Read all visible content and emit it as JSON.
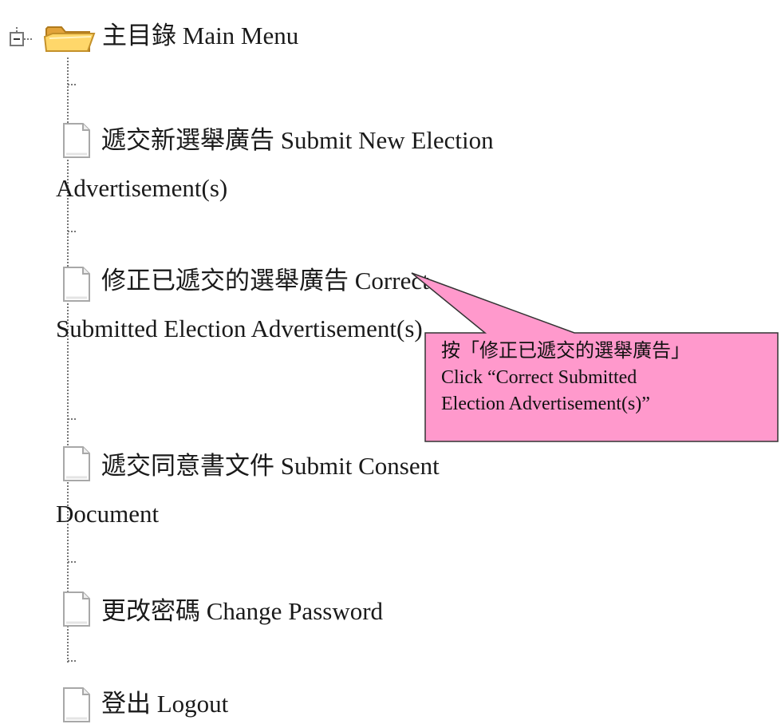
{
  "tree": {
    "root": {
      "label": "主目錄 Main Menu",
      "toggle_icon": "collapse-minus-icon",
      "folder_icon": "open-folder-icon",
      "expanded": true
    },
    "items": [
      {
        "label": "遞交新選舉廣告 Submit New Election Advertisement(s)",
        "icon": "document-icon"
      },
      {
        "label": "修正已遞交的選舉廣告 Correct Submitted Election Advertisement(s)",
        "icon": "document-icon"
      },
      {
        "label": "遞交同意書文件 Submit Consent Document",
        "icon": "document-icon"
      },
      {
        "label": "更改密碼 Change Password",
        "icon": "document-icon"
      },
      {
        "label": "登出 Logout",
        "icon": "document-icon"
      }
    ]
  },
  "callout": {
    "line1": "按「修正已遞交的選舉廣告」",
    "line2": "Click “Correct Submitted",
    "line3": "Election Advertisement(s)”",
    "fill_color": "#ff99cc",
    "border_color": "#333333"
  }
}
